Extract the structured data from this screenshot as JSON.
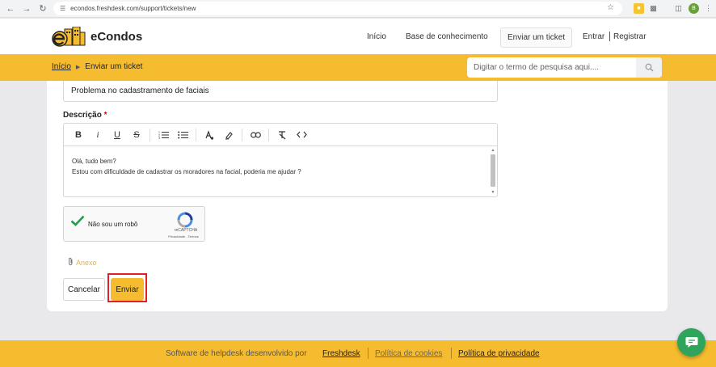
{
  "browser": {
    "url": "econdos.freshdesk.com/support/tickets/new",
    "avatar_letter": "B"
  },
  "header": {
    "brand": "eCondos",
    "nav": {
      "inicio": "Início",
      "base": "Base de conhecimento",
      "enviar": "Enviar um ticket",
      "entrar": "Entrar",
      "registrar": "Registrar"
    }
  },
  "subheader": {
    "breadcrumb_home": "Início",
    "breadcrumb_current": "Enviar um ticket",
    "search_placeholder": "Digitar o termo de pesquisa aqui...."
  },
  "form": {
    "subject_value": "Problema no cadastramento de faciais",
    "description_label": "Descrição",
    "required_mark": "*",
    "toolbar": {
      "bold": "B",
      "italic": "i",
      "underline": "U",
      "strike": "S"
    },
    "description_lines": [
      "Olá, tudo bem?",
      "Estou com dificuldade de cadastrar os moradores na facial, poderia me ajudar ?"
    ],
    "captcha_label": "Não sou um robô",
    "captcha_brand": "reCAPTCHA",
    "captcha_terms": "Privacidade - Termos",
    "attachment_label": "Anexo",
    "cancel_label": "Cancelar",
    "submit_label": "Enviar"
  },
  "footer": {
    "text": "Software de helpdesk desenvolvido por",
    "link_freshdesk": "Freshdesk",
    "link_cookies": "Política de cookies",
    "link_privacy": "Política de privacidade"
  },
  "colors": {
    "brand_yellow": "#f6bc2f",
    "highlight_red": "#e21f26",
    "chat_green": "#2ea55a"
  }
}
